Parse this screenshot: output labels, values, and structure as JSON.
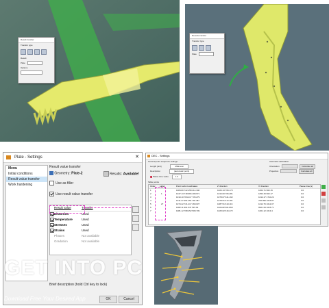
{
  "panel1": {
    "dialog": {
      "title": "Result transfer",
      "label1": "Transfer type",
      "label2": "Result",
      "field_label": "Plate",
      "field_value": "Plate_surface",
      "label3": "Options"
    }
  },
  "panel2": {
    "dialog": {
      "title": "Results transfer",
      "label1": "Transfer type",
      "field_label": "Plate",
      "field_value": "Plate_surface"
    }
  },
  "plate_settings": {
    "title": "Plate - Settings",
    "close": "✕",
    "menu_header": "Menu",
    "menu_items": [
      "Initial conditions",
      "Result value transfer",
      "Work hardening"
    ],
    "section_title": "Result value transfer",
    "geometry_label": "Geometry:",
    "geometry_value": "Plate-2",
    "results_label": "Results:",
    "results_value": "Available!",
    "use_as_filler": "Use as filler",
    "use_result_value_transfer": "Use result value transfer",
    "table_headers": [
      "Result value",
      "Transfer"
    ],
    "table_rows": [
      {
        "name": "Distortion",
        "state": "Used",
        "checked": true
      },
      {
        "name": "Temperature",
        "state": "Used",
        "checked": true
      },
      {
        "name": "Stresses",
        "state": "Used",
        "checked": true
      },
      {
        "name": "Strains",
        "state": "Used",
        "checked": true
      },
      {
        "name": "Phases",
        "state": "Not available",
        "checked": false
      },
      {
        "name": "Gradation",
        "state": "Not available",
        "checked": false
      }
    ],
    "brief_description": "Brief description (hold Ctrl key to lock)",
    "ok_label": "OK",
    "cancel_label": "Cancel"
  },
  "dec_settings": {
    "title": "DEC - Settings",
    "section1": "General point sequence settings",
    "row1_label": "Length [unit]",
    "row1_value": "Millimeter",
    "row2_label": "Description",
    "row2_value": "(automatic point)",
    "pause_label": "Pause time value",
    "pause_value": "1.0",
    "auto_title": "Automatic calculation",
    "orientation_label": "Orientation",
    "projection_label": "Projection",
    "calculate_label": "Calculate all",
    "table_title": "Table points",
    "columns": [
      "Order",
      "Label",
      "Point world coordinates",
      "Z' direction",
      "X' direction",
      "Pause time [s]"
    ],
    "rows": [
      [
        "1",
        "",
        "1084.80  722.458  214.346",
        "1026.13  706.173",
        "1062.71  962.15",
        "0.0"
      ],
      [
        "2",
        "1",
        "1047.13  718.984  408.671",
        "1016.00  706.281",
        "1053.15  962.17",
        "0.0"
      ],
      [
        "3",
        "",
        "1010.10  784.417  735.279",
        "1078.07  641.192",
        "1012.17  1710.22",
        "0.0"
      ],
      [
        "4",
        "",
        "1011.37  664.452  736.487",
        "1078.51  672.181",
        "700.999  1016.87",
        "0.0"
      ],
      [
        "5",
        "27",
        "1074.22  721.417  468.037",
        "1087.51  610.119",
        "1012.76  1012.07",
        "0.0"
      ],
      [
        "6",
        "",
        "1082.11  901.647  515.94",
        "1024.82  601.860",
        "992.134  1015.71",
        "0.0"
      ],
      [
        "7",
        "",
        "1081.12  708.252  508.749",
        "1025.62  616.272",
        "1001.12  1013.4",
        "0.0"
      ]
    ]
  },
  "watermark": {
    "title": "GET INTO PC",
    "subtitle": "Download Free Your Desired App"
  },
  "colors": {
    "render_bg": "#4f6e68",
    "yellow_part": "#e5ea6c",
    "green_part": "#3fb04a",
    "magenta_highlight": "#e040c8",
    "arrow_green": "#2fae44"
  }
}
